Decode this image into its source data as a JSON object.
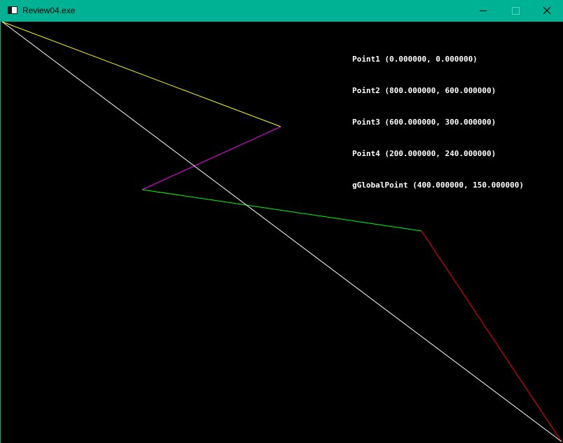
{
  "window": {
    "title": "Review04.exe",
    "title_bar_color": "#00b294"
  },
  "title_bar_buttons": {
    "minimize_icon": "minimize-icon",
    "maximize_icon": "maximize-icon",
    "close_icon": "close-icon"
  },
  "canvas": {
    "background": "#000000",
    "info_lines": [
      "Point1 (0.000000, 0.000000)",
      "Point2 (800.000000, 600.000000)",
      "Point3 (600.000000, 300.000000)",
      "Point4 (200.000000, 240.000000)",
      "gGlobalPoint (400.000000, 150.000000)"
    ],
    "segments": [
      {
        "id": "point1-to-global",
        "color": "#ffff00"
      },
      {
        "id": "global-to-point4",
        "color": "#ff00ff"
      },
      {
        "id": "point4-to-point3",
        "color": "#00ff00"
      },
      {
        "id": "point3-to-point2",
        "color": "#ff0000"
      },
      {
        "id": "point1-to-point2",
        "color": "#ffffff"
      }
    ]
  }
}
